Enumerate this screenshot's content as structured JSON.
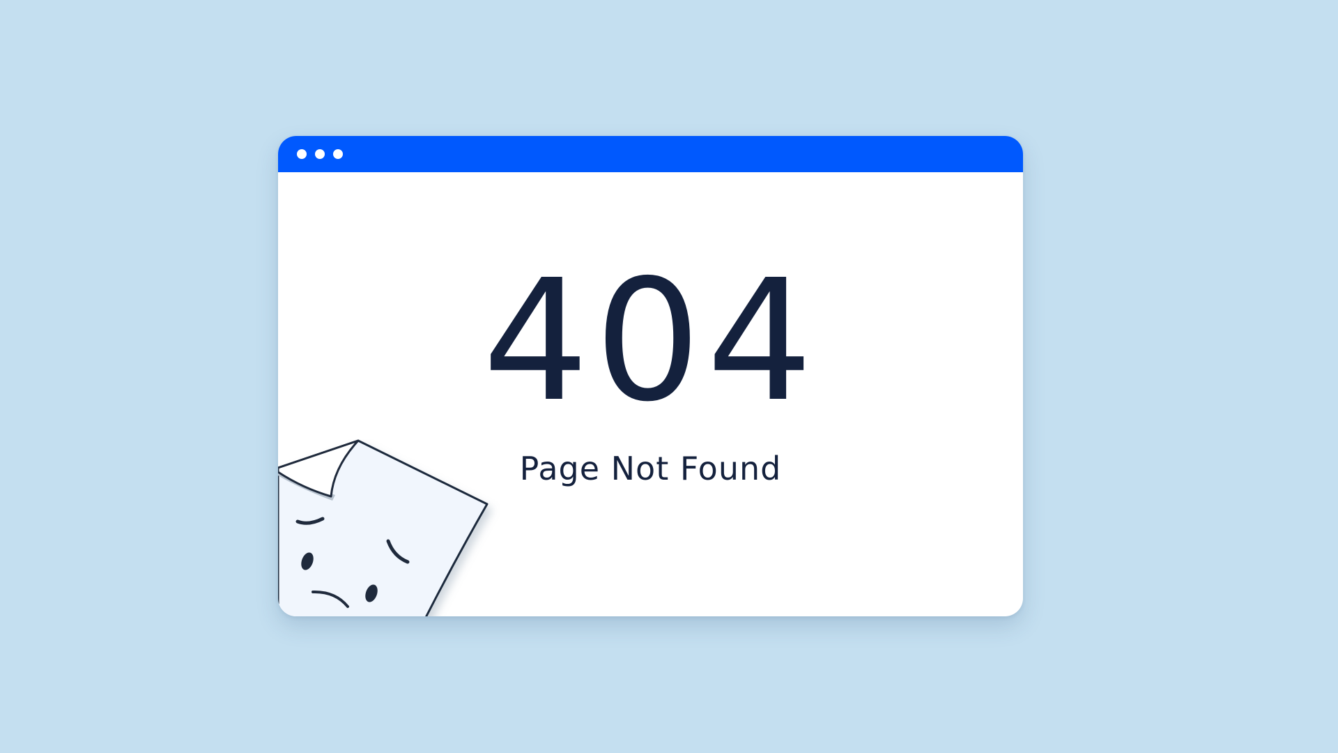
{
  "window": {
    "dots": [
      "dot-1",
      "dot-2",
      "dot-3"
    ],
    "title_bar_color": "#0059fe"
  },
  "error": {
    "code": "404",
    "message": "Page Not Found"
  },
  "illustration": {
    "icon": "sad-page-icon"
  },
  "colors": {
    "background": "#c4dff0",
    "text": "#14213d",
    "accent": "#0059fe"
  }
}
